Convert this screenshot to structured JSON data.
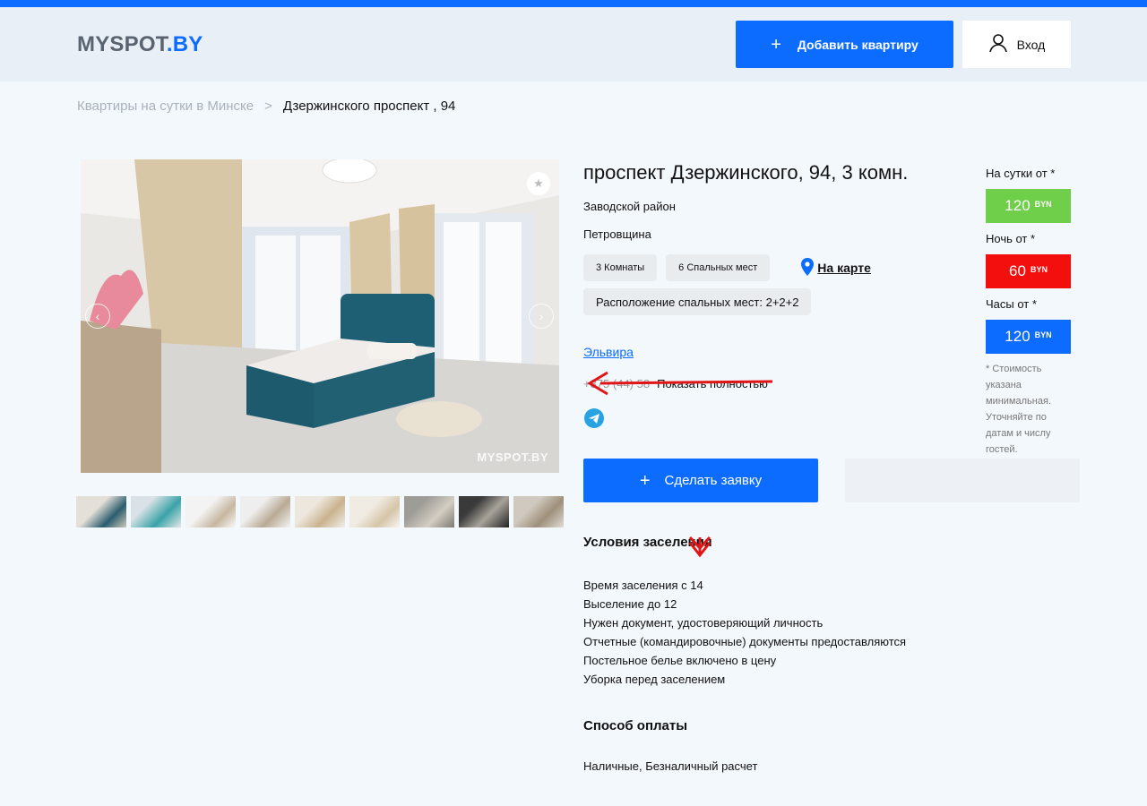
{
  "header": {
    "logo_part1": "MYSPOT",
    "logo_part2": ".BY",
    "add_button": "Добавить квартиру",
    "login_button": "Вход"
  },
  "breadcrumb": {
    "parent": "Квартиры на сутки в Минске",
    "separator": ">",
    "current": "Дзержинского проспект , 94"
  },
  "gallery": {
    "watermark": "MYSPOT.BY",
    "thumbnail_count": 9
  },
  "listing": {
    "title": "проспект Дзержинского, 94, 3 комн.",
    "district": "Заводской район",
    "microdistrict": "Петровщина",
    "rooms_tag": "3 Комнаты",
    "beds_tag": "6 Спальных мест",
    "map_link": "На карте",
    "sleeping_arrangement": "Расположение спальных мест: 2+2+2",
    "owner_name": "Эльвира",
    "phone_partial": "+375 (44) 58",
    "show_phone": "Показать полностью",
    "request_button": "Сделать заявку"
  },
  "prices": {
    "day_label": "На сутки от *",
    "day_value": "120",
    "night_label": "Ночь от *",
    "night_value": "60",
    "hours_label": "Часы от *",
    "hours_value": "120",
    "currency": "BYN",
    "note": "* Стоимость указана минимальная. Уточняйте по датам и числу гостей.",
    "colors": {
      "day": "#6fcf4a",
      "night": "#f40f0f",
      "hours": "#0b6cff"
    }
  },
  "conditions": {
    "heading": "Условия заселения",
    "items": [
      "Время заселения с 14",
      "Выселение до 12",
      "Нужен документ, удостоверяющий личность",
      "Отчетные (командировочные) документы предоставляются",
      "Постельное белье включено в цену",
      "Уборка перед заселением"
    ]
  },
  "payment": {
    "heading": "Способ оплаты",
    "methods": "Наличные, Безналичный расчет"
  },
  "icons": {
    "add": "plus-icon",
    "login": "user-icon",
    "favorite": "star-icon",
    "map": "map-pin-icon",
    "messenger": "telegram-icon"
  },
  "colors": {
    "accent": "#0b6cff",
    "annotation_arrow": "#e01515"
  }
}
